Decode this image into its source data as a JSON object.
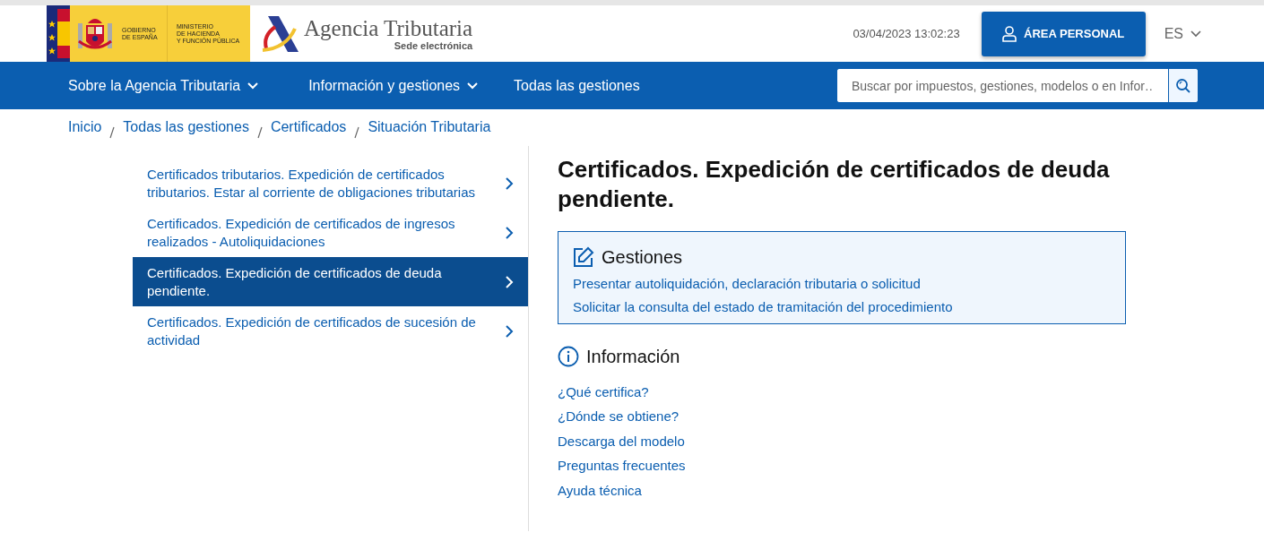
{
  "header": {
    "government": "GOBIERNO\nDE ESPAÑA",
    "ministry": "MINISTERIO\nDE HACIENDA\nY FUNCIÓN PÚBLICA",
    "agency": "Agencia Tributaria",
    "agency_sub": "Sede electrónica",
    "datetime": "03/04/2023 13:02:23",
    "personal_button": "ÁREA PERSONAL",
    "language": "ES"
  },
  "nav": {
    "items": [
      {
        "label": "Sobre la Agencia Tributaria",
        "dropdown": true
      },
      {
        "label": "Información y gestiones",
        "dropdown": true
      },
      {
        "label": "Todas las gestiones",
        "dropdown": false
      }
    ],
    "search": {
      "placeholder": "Buscar por impuestos, gestiones, modelos o en Infor…"
    }
  },
  "breadcrumb": [
    "Inicio",
    "Todas las gestiones",
    "Certificados",
    "Situación Tributaria"
  ],
  "sidebar": {
    "items": [
      {
        "label": "Certificados tributarios. Expedición de certificados tributarios. Estar al corriente de obligaciones tributarias",
        "selected": false
      },
      {
        "label": "Certificados. Expedición de certificados de ingresos realizados - Autoliquidaciones",
        "selected": false
      },
      {
        "label": "Certificados. Expedición de certificados de deuda pendiente.",
        "selected": true
      },
      {
        "label": "Certificados. Expedición de certificados de sucesión de actividad",
        "selected": false
      }
    ]
  },
  "main": {
    "title": "Certificados. Expedición de certificados de deuda pendiente.",
    "gestiones": {
      "title": "Gestiones",
      "links": [
        "Presentar autoliquidación, declaración tributaria o solicitud",
        "Solicitar la consulta del estado de tramitación del procedimiento"
      ]
    },
    "informacion": {
      "title": "Información",
      "links": [
        "¿Qué certifica?",
        "¿Dónde se obtiene?",
        "Descarga del modelo",
        "Preguntas frecuentes",
        "Ayuda técnica"
      ]
    }
  }
}
